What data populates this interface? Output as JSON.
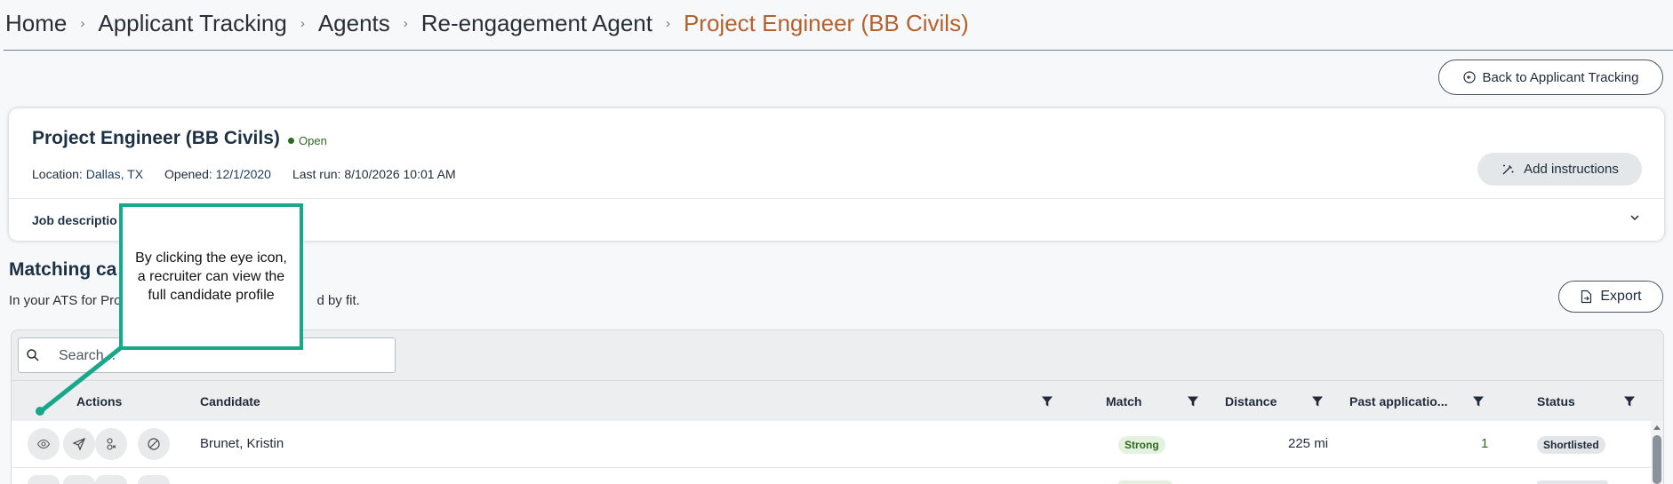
{
  "breadcrumb": {
    "items": [
      "Home",
      "Applicant Tracking",
      "Agents",
      "Re-engagement Agent"
    ],
    "current": "Project Engineer (BB Civils)",
    "separator": "›"
  },
  "back_button": {
    "label": "Back to Applicant Tracking",
    "icon": "arrow-circle-left-icon"
  },
  "job": {
    "title": "Project Engineer (BB Civils)",
    "status": "Open",
    "status_color": "#2d6a1f",
    "location_label": "Location:",
    "location": "Dallas, TX",
    "opened_label": "Opened:",
    "opened": "12/1/2020",
    "last_run": "Last run: 8/10/2026 10:01 AM",
    "add_instructions_label": "Add instructions",
    "job_description_label": "Job descriptio"
  },
  "matching": {
    "heading": "Matching ca",
    "subtitle_start": "In your ATS for Pro",
    "subtitle_end": "d by fit.",
    "export_label": "Export"
  },
  "search": {
    "placeholder": "Search..."
  },
  "table": {
    "headers": {
      "actions": "Actions",
      "candidate": "Candidate",
      "match": "Match",
      "distance": "Distance",
      "past_applications": "Past applicatio...",
      "status": "Status"
    },
    "rows": [
      {
        "candidate": "Brunet, Kristin",
        "match": "Strong",
        "distance": "225 mi",
        "past_applications": "1",
        "status": "Shortlisted"
      }
    ]
  },
  "callout": {
    "text": "By clicking the eye icon, a recruiter can view the full candidate profile",
    "color": "#17a88b"
  },
  "colors": {
    "accent_breadcrumb": "#b5612e",
    "match_strong_bg": "#e4f1df"
  }
}
